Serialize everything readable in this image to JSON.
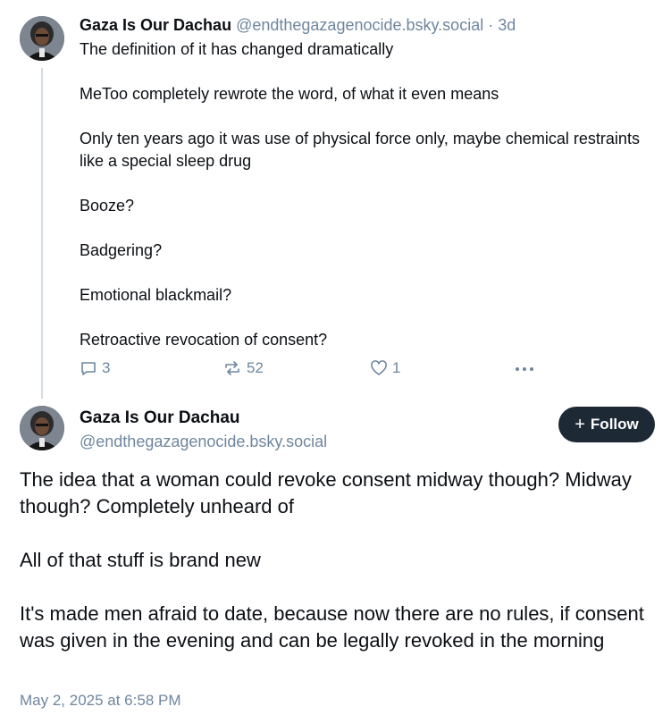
{
  "post1": {
    "display_name": "Gaza Is Our Dachau",
    "handle": "@endthegazagenocide.bsky.social",
    "separator": "·",
    "age": "3d",
    "paragraphs": [
      "The definition of it has changed dramatically",
      "MeToo completely rewrote the word, of what it even means",
      "Only ten years ago it was use of physical force only, maybe chemical restraints like a special sleep drug",
      "Booze?",
      "Badgering?",
      "Emotional blackmail?",
      "Retroactive revocation of consent?"
    ],
    "actions": {
      "reply_icon": "reply-bubble-icon",
      "reply_count": "3",
      "repost_icon": "repost-icon",
      "repost_count": "52",
      "like_icon": "heart-icon",
      "like_count": "1",
      "more_icon": "ellipsis-icon"
    }
  },
  "post2": {
    "display_name": "Gaza Is Our Dachau",
    "handle": "@endthegazagenocide.bsky.social",
    "follow_label": "Follow",
    "follow_icon": "plus-icon",
    "paragraphs": [
      "The idea that a woman could revoke consent midway though? Midway though?  Completely unheard of",
      "All of that stuff is brand new",
      "It's made men afraid to date, because now there are no rules, if consent was given in the evening and can be legally revoked in the morning"
    ],
    "timestamp": "May 2, 2025 at 6:58 PM"
  },
  "colors": {
    "text": "#0b0f14",
    "muted": "#6f869f",
    "follow_button_bg": "#1e2936",
    "thread_line": "#d4dbe2"
  }
}
